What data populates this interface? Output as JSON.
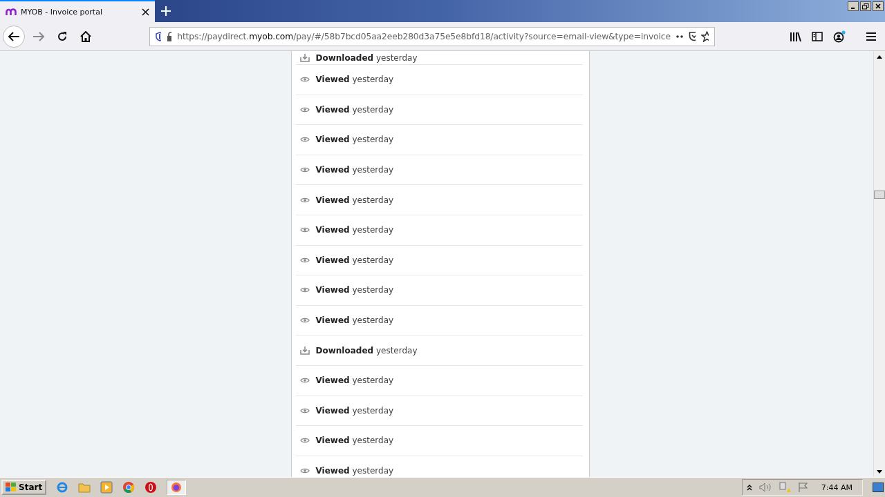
{
  "browser": {
    "tab": {
      "title": "MYOB - Invoice portal",
      "selected": true
    },
    "url": {
      "prefix": "https://paydirect.",
      "domain": "myob.com",
      "path": "/pay/#/58b7bcd05aa2eeb280d3a75e5e8bfd18/activity?source=email-view&type=invoice"
    }
  },
  "activity": [
    {
      "kind": "download",
      "text": "**Downloaded** yesterday"
    },
    {
      "kind": "view",
      "text": "**Viewed** yesterday"
    },
    {
      "kind": "view",
      "text": "**Viewed** yesterday"
    },
    {
      "kind": "view",
      "text": "**Viewed** yesterday"
    },
    {
      "kind": "view",
      "text": "**Viewed** yesterday"
    },
    {
      "kind": "view",
      "text": "**Viewed** yesterday"
    },
    {
      "kind": "view",
      "text": "**Viewed** yesterday"
    },
    {
      "kind": "view",
      "text": "**Viewed** yesterday"
    },
    {
      "kind": "view",
      "text": "**Viewed** yesterday"
    },
    {
      "kind": "view",
      "text": "**Viewed** yesterday"
    },
    {
      "kind": "download",
      "text": "**Downloaded** yesterday"
    },
    {
      "kind": "view",
      "text": "**Viewed** yesterday"
    },
    {
      "kind": "view",
      "text": "**Viewed** yesterday"
    },
    {
      "kind": "view",
      "text": "**Viewed** yesterday"
    },
    {
      "kind": "view",
      "text": "**Viewed** yesterday"
    }
  ],
  "taskbar": {
    "start": "Start",
    "clock": "7:44 AM"
  }
}
